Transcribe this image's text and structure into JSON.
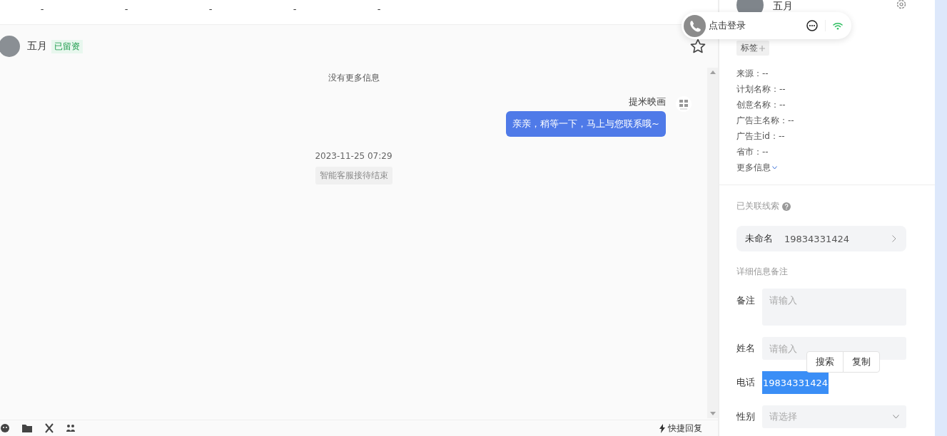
{
  "stats": [
    {
      "value": "-"
    },
    {
      "value": "-"
    },
    {
      "value": "-"
    },
    {
      "value": "-"
    },
    {
      "value": "-"
    }
  ],
  "chat": {
    "contact": {
      "name": "五月",
      "badge": "已留资"
    },
    "starred": false,
    "messages": [
      {
        "kind": "notice",
        "text": "没有更多信息"
      },
      {
        "kind": "outgoing",
        "sender": "提米映画",
        "text": "亲亲，稍等一下，马上与您联系哦~"
      },
      {
        "kind": "time",
        "text": "2023-11-25 07:29"
      },
      {
        "kind": "system",
        "text": "智能客服接待结束"
      }
    ],
    "quick_reply": "快捷回复"
  },
  "call_widget": {
    "label": "点击登录"
  },
  "profile": {
    "name": "五月",
    "tag_button": "标签",
    "info": [
      "来源：--",
      "计划名称：--",
      "创意名称：--",
      "广告主名称：--",
      "广告主id：--",
      "省市：--"
    ],
    "more_link": "更多信息"
  },
  "linked": {
    "title": "已关联线索",
    "lead": {
      "name": "未命名",
      "phone": "19834331424"
    }
  },
  "details": {
    "title": "详细信息备注",
    "fields": [
      {
        "kind": "textarea",
        "label": "备注",
        "placeholder": "请输入"
      },
      {
        "kind": "input",
        "label": "姓名",
        "placeholder": "请输入"
      },
      {
        "kind": "selected_text",
        "label": "电话",
        "value": "19834331424"
      },
      {
        "kind": "select",
        "label": "性别",
        "placeholder": "请选择"
      }
    ]
  },
  "context_menu": [
    "搜索",
    "复制"
  ]
}
